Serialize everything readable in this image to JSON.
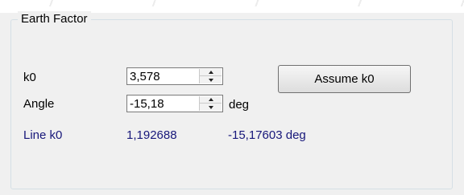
{
  "group": {
    "title": "Earth Factor"
  },
  "k0": {
    "label": "k0",
    "value": "3,578"
  },
  "angle": {
    "label": "Angle",
    "value": "-15,18",
    "unit": "deg"
  },
  "assume_button": {
    "label": "Assume k0"
  },
  "line_k0": {
    "label": "Line k0",
    "value": "1,192688",
    "angle_value": "-15,17603 deg"
  },
  "icons": {
    "spin_up": "spin-up-arrow-icon",
    "spin_down": "spin-down-arrow-icon"
  },
  "colors": {
    "background": "#f0f0f0",
    "group_border": "#d5dfe5",
    "info_text": "#17177a",
    "input_border": "#7a7a7a"
  }
}
